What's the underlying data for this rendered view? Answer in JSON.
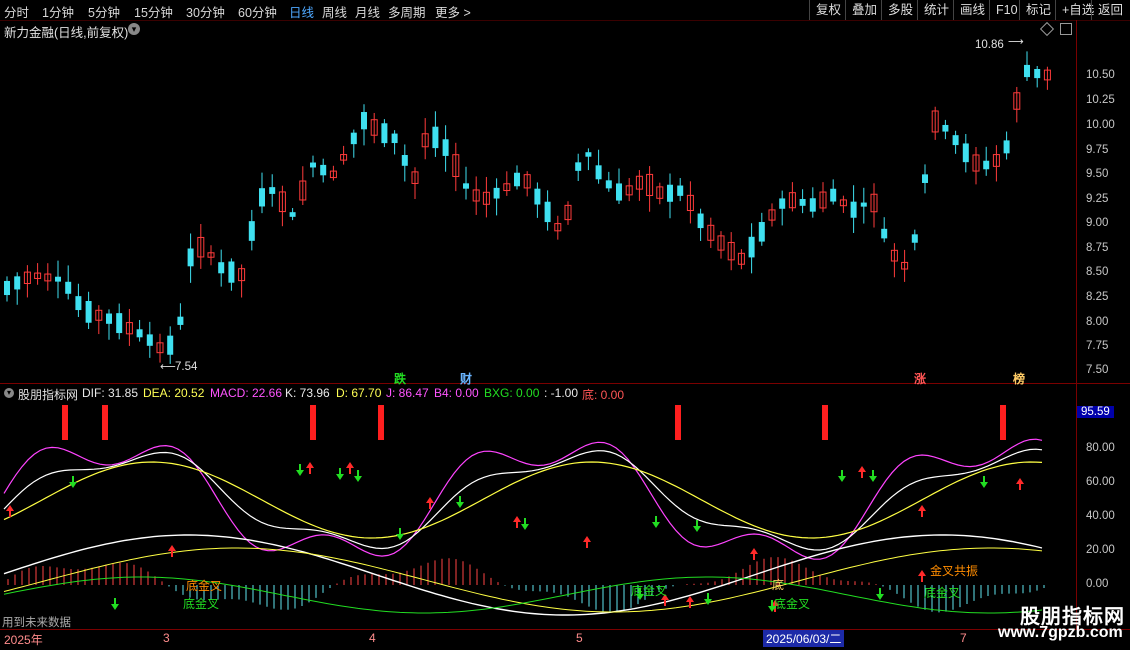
{
  "toolbar": {
    "periods": [
      "分时",
      "1分钟",
      "5分钟",
      "15分钟",
      "30分钟",
      "60分钟",
      "日线",
      "周线",
      "月线",
      "多周期",
      "更多 >"
    ],
    "active": "日线",
    "right_buttons": [
      "复权",
      "叠加",
      "多股",
      "统计",
      "画线",
      "F10",
      "标记",
      "+自选",
      "返回"
    ]
  },
  "chart": {
    "title": "新力金融(日线,前复权)",
    "price_axis": [
      "10.50",
      "10.25",
      "10.00",
      "9.75",
      "9.50",
      "9.25",
      "9.00",
      "8.75",
      "8.50",
      "8.25",
      "8.00",
      "7.75",
      "7.50"
    ],
    "high_label": "10.86",
    "low_label": "7.54",
    "tags": [
      {
        "text": "跌",
        "color": "#22dd22"
      },
      {
        "text": "财",
        "color": "#6ab4ff"
      },
      {
        "text": "涨",
        "color": "#ff5555"
      },
      {
        "text": "榜",
        "color": "#ffcc66"
      }
    ]
  },
  "indicator": {
    "name": "股朋指标网",
    "values": [
      {
        "text": "DIF: 31.85",
        "color": "#e8e8e8"
      },
      {
        "text": "DEA: 20.52",
        "color": "#ffff55"
      },
      {
        "text": "MACD: 22.66",
        "color": "#ff55ff"
      },
      {
        "text": "K: 73.96",
        "color": "#e8e8e8"
      },
      {
        "text": "D: 67.70",
        "color": "#ffff55"
      },
      {
        "text": "J: 86.47",
        "color": "#ff55ff"
      },
      {
        "text": "B4: 0.00",
        "color": "#ff55ff"
      },
      {
        "text": "BXG: 0.00",
        "color": "#22dd22"
      },
      {
        "text": ": -1.00",
        "color": "#e8e8e8"
      },
      {
        "text": "底: 0.00",
        "color": "#ff5555"
      }
    ],
    "axis": [
      "80.00",
      "60.00",
      "40.00",
      "20.00",
      "0.00"
    ],
    "current": "95.59",
    "annotations": [
      {
        "text": "底金叉",
        "color": "#22dd22"
      },
      {
        "text": "底金叉",
        "color": "#22dd22"
      },
      {
        "text": "底金叉",
        "color": "#22dd22"
      },
      {
        "text": "底金叉",
        "color": "#22dd22"
      },
      {
        "text": "金叉共振",
        "color": "#ff8c00"
      },
      {
        "text": "底金叉",
        "color": "#ff8c00"
      },
      {
        "text": "底",
        "color": "#ffcc66"
      }
    ]
  },
  "time_axis": {
    "labels": [
      "2025年",
      "3",
      "4",
      "5",
      "2025/06/03/二",
      "7"
    ],
    "footer": "用到未来数据"
  },
  "watermark": {
    "name": "股朋指标网",
    "url": "www.7gpzb.com"
  }
}
